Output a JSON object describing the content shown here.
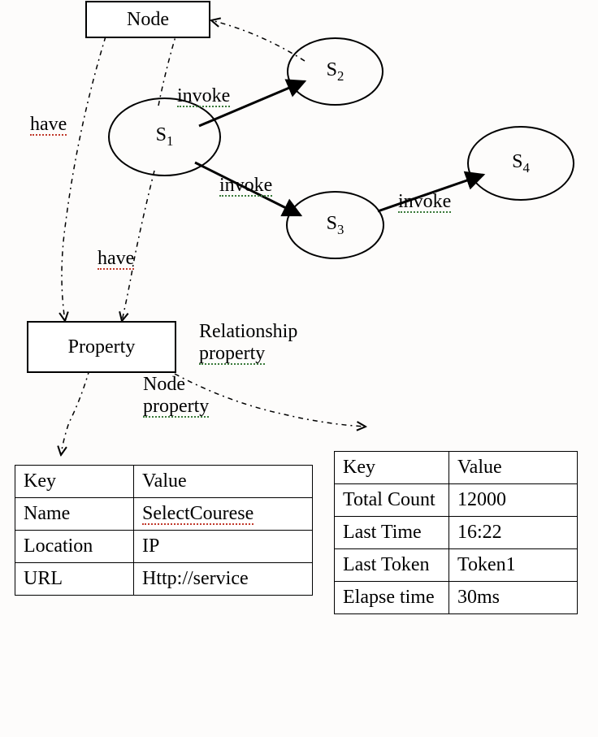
{
  "nodes": {
    "node_box": "Node",
    "s1": "S",
    "s1_sub": "1",
    "s2": "S",
    "s2_sub": "2",
    "s3": "S",
    "s3_sub": "3",
    "s4": "S",
    "s4_sub": "4",
    "property_box": "Property"
  },
  "edge_labels": {
    "invoke_s1_s2": "invoke",
    "invoke_s1_s3": "invoke",
    "invoke_s3_s4": "invoke",
    "have_node_prop": "have",
    "have_s1_prop": "have"
  },
  "branch_labels": {
    "relationship_property": "Relationship property",
    "relationship_word": "Relationship",
    "property_word1": "property",
    "node_property": "Node property",
    "node_word": "Node",
    "property_word2": "property"
  },
  "tables": {
    "node_property": {
      "header_key": "Key",
      "header_value": "Value",
      "rows": [
        {
          "key": "Name",
          "value": "SelectCourese"
        },
        {
          "key": "Location",
          "value": "IP"
        },
        {
          "key": "URL",
          "value": "Http://service"
        }
      ]
    },
    "relationship_property": {
      "header_key": "Key",
      "header_value": "Value",
      "rows": [
        {
          "key": "Total Count",
          "value": "12000"
        },
        {
          "key": "Last Time",
          "value": "16:22"
        },
        {
          "key": "Last Token",
          "value": "Token1"
        },
        {
          "key": "Elapse time",
          "value": "30ms"
        }
      ]
    }
  }
}
